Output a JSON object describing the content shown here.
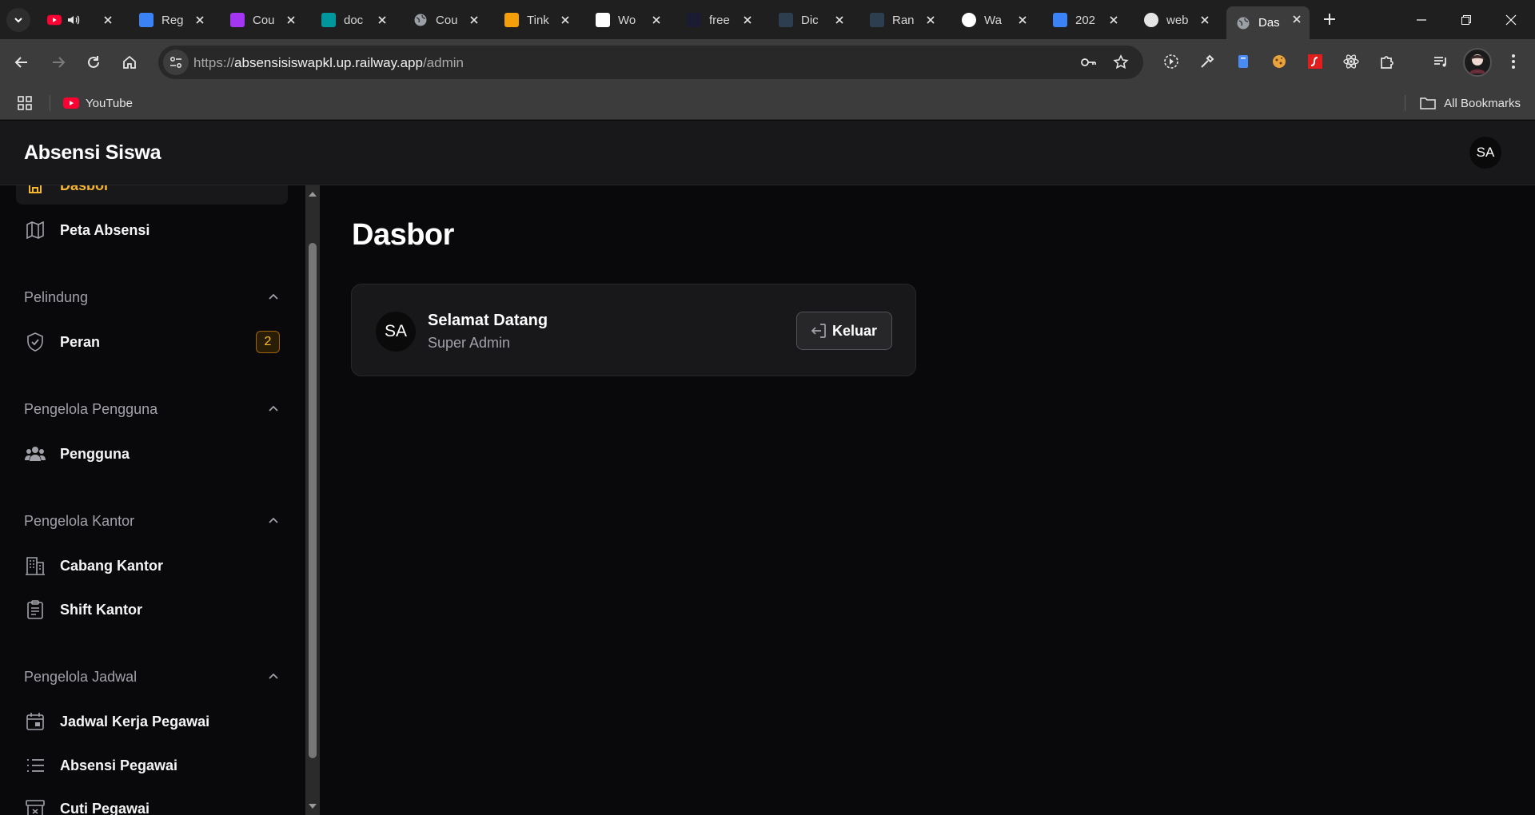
{
  "browser": {
    "tabs": [
      {
        "title": "",
        "favicon": "youtube-icon",
        "color": "#ff0033"
      },
      {
        "title": "Reg",
        "favicon": "register-icon",
        "color": "#3b82f6"
      },
      {
        "title": "Cou",
        "favicon": "udemy-icon",
        "color": "#a435f0"
      },
      {
        "title": "doc",
        "favicon": "arduino-icon",
        "color": "#00979d"
      },
      {
        "title": "Cou",
        "favicon": "globe-icon",
        "color": "#9aa0a6"
      },
      {
        "title": "Tink",
        "favicon": "tinkercad-icon",
        "color": "#f59e0b"
      },
      {
        "title": "Wo",
        "favicon": "wordpress-icon",
        "color": "#ffffff"
      },
      {
        "title": "free",
        "favicon": "freecodecamp-icon",
        "color": "#1b1b32"
      },
      {
        "title": "Dic",
        "favicon": "dicoding-icon",
        "color": "#2d3e50"
      },
      {
        "title": "Ran",
        "favicon": "dicoding-icon",
        "color": "#2d3e50"
      },
      {
        "title": "Wa",
        "favicon": "openai-icon",
        "color": "#ffffff"
      },
      {
        "title": "202",
        "favicon": "key-icon",
        "color": "#3b82f6"
      },
      {
        "title": "web",
        "favicon": "web-icon",
        "color": "#e5e5e5"
      },
      {
        "title": "Das",
        "favicon": "globe-icon",
        "color": "#9aa0a6",
        "active": true
      }
    ],
    "url_scheme": "https://",
    "url_host": "absensisiswapkl.up.railway.app",
    "url_path": "/admin",
    "bookmarks": [
      {
        "label": "YouTube",
        "icon": "youtube-icon"
      }
    ],
    "all_bookmarks_label": "All Bookmarks"
  },
  "app": {
    "brand": "Absensi Siswa",
    "user_initials": "SA",
    "accent": "#f5b52e"
  },
  "sidebar": {
    "items": {
      "dasbor": {
        "label": "Dasbor",
        "icon": "home-icon",
        "active": true
      },
      "peta_absensi": {
        "label": "Peta Absensi",
        "icon": "map-icon"
      },
      "peran": {
        "label": "Peran",
        "icon": "shield-check-icon",
        "badge": "2"
      },
      "pengguna": {
        "label": "Pengguna",
        "icon": "users-icon"
      },
      "cabang_kantor": {
        "label": "Cabang Kantor",
        "icon": "building-icon"
      },
      "shift_kantor": {
        "label": "Shift Kantor",
        "icon": "clipboard-icon"
      },
      "jadwal_kerja": {
        "label": "Jadwal Kerja Pegawai",
        "icon": "calendar-icon"
      },
      "absensi_pegawai": {
        "label": "Absensi Pegawai",
        "icon": "list-icon"
      },
      "cuti_pegawai": {
        "label": "Cuti Pegawai",
        "icon": "archive-icon"
      }
    },
    "groups": {
      "pelindung": "Pelindung",
      "pengelola_pengguna": "Pengelola Pengguna",
      "pengelola_kantor": "Pengelola Kantor",
      "pengelola_jadwal": "Pengelola Jadwal"
    }
  },
  "main": {
    "title": "Dasbor",
    "welcome": {
      "initials": "SA",
      "heading": "Selamat Datang",
      "subtitle": "Super Admin",
      "logout_label": "Keluar"
    }
  }
}
